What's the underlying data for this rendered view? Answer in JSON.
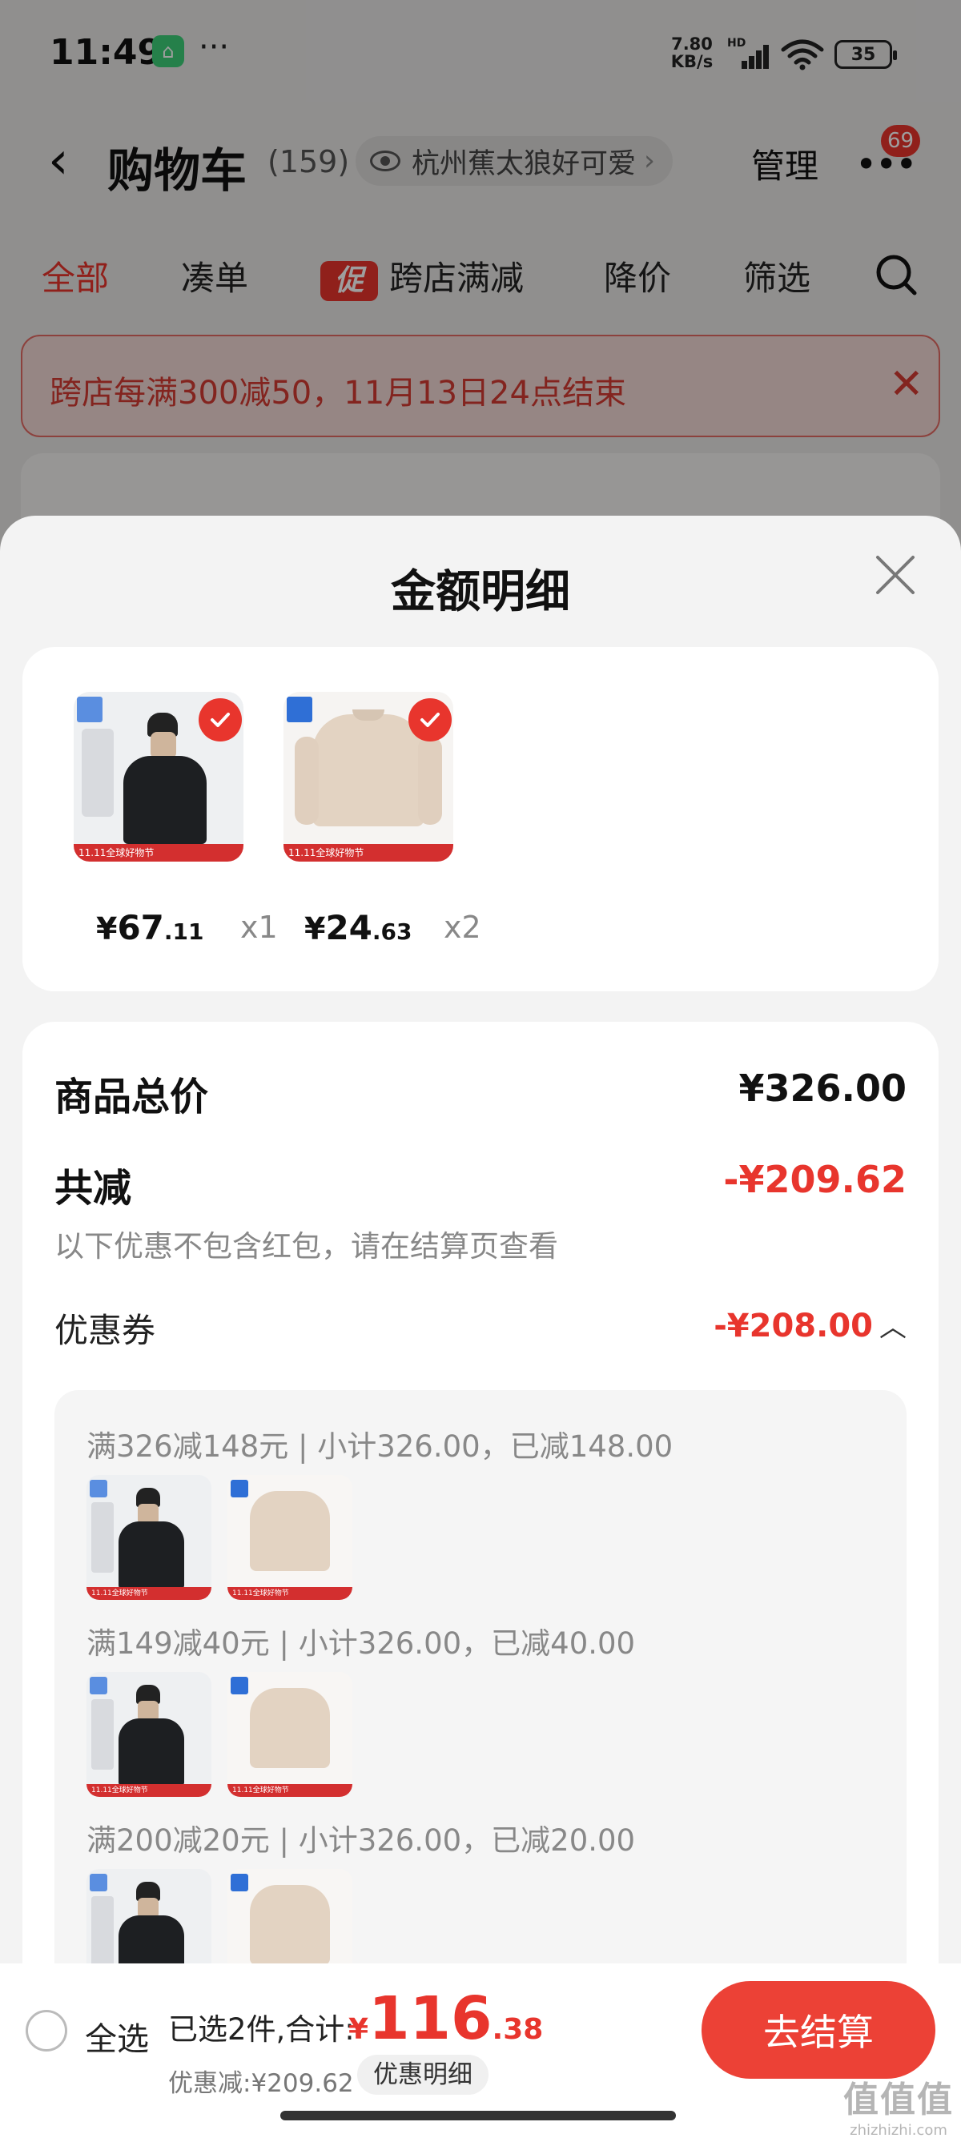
{
  "status_bar": {
    "time": "11:49",
    "app_badge_icon": "mi-home-icon",
    "more": "···",
    "net_speed_value": "7.80",
    "net_speed_unit": "KB/s",
    "signal_label": "HD",
    "battery": "35"
  },
  "top_nav": {
    "title": "购物车",
    "count": "(159)",
    "location": "杭州蕉太狼好可爱",
    "location_chevron": "›",
    "manage": "管理",
    "menu_badge": "69"
  },
  "filter_tabs": [
    {
      "label": "全部",
      "active": true
    },
    {
      "label": "凑单",
      "active": false
    },
    {
      "label": "跨店满减",
      "active": false,
      "tag": "促"
    },
    {
      "label": "降价",
      "active": false
    },
    {
      "label": "筛选",
      "active": false
    }
  ],
  "notice": {
    "text": "跨店每满300减50，11月13日24点结束",
    "close": "✕"
  },
  "sheet": {
    "title": "金额明细",
    "products": [
      {
        "kind": "jacket",
        "price_yen": "¥",
        "price_int": "67",
        "price_dec": ".11",
        "qty": "x1",
        "promo_text": "11.11全球好物节"
      },
      {
        "kind": "sweater",
        "price_yen": "¥",
        "price_int": "24",
        "price_dec": ".63",
        "qty": "x2",
        "promo_text": "11.11全球好物节"
      }
    ],
    "total_label": "商品总价",
    "total_value": "¥326.00",
    "reduce_label": "共减",
    "reduce_value": "-¥209.62",
    "reduce_note": "以下优惠不包含红包，请在结算页查看",
    "coupon_label": "优惠券",
    "coupon_value": "-¥208.00",
    "coupon_caret": "︿",
    "coupon_rules": [
      "满326减148元 | 小计326.00，已减148.00",
      "满149减40元 | 小计326.00，已减40.00",
      "满200减20元 | 小计326.00，已减20.00"
    ]
  },
  "checkout": {
    "select_all": "全选",
    "selected_summary": "已选2件,合计:",
    "total_yen": "¥",
    "total_int": "116",
    "total_dec": ".38",
    "discount_text": "优惠减:¥209.62",
    "discount_detail": "优惠明细",
    "checkout_button": "去结算"
  },
  "watermark": {
    "big": "值值值",
    "small": "zhizhizhi.com"
  },
  "colors": {
    "accent_red": "#e8352d",
    "checkout_red": "#ec4136",
    "text_gray": "#888888"
  }
}
